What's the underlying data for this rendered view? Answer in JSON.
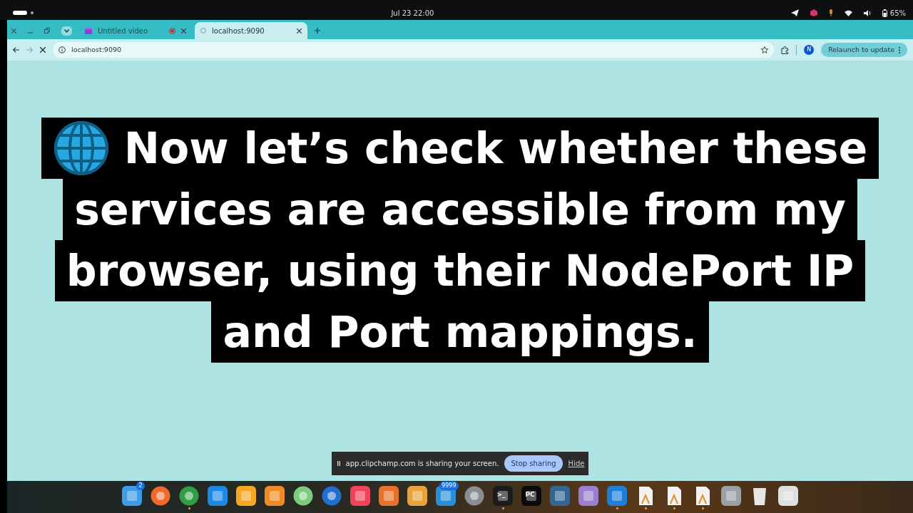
{
  "top_bar": {
    "clock": "Jul 23  22:00",
    "battery": "65%"
  },
  "tabs": [
    {
      "title": "Untitled video",
      "selected": false,
      "recording": true
    },
    {
      "title": "localhost:9090",
      "selected": true,
      "recording": false
    }
  ],
  "toolbar": {
    "loading": true,
    "forward_disabled": true,
    "url": "localhost:9090",
    "profile": "N",
    "relaunch": "Relaunch to update"
  },
  "caption": {
    "lines": [
      "Now let’s check whether these",
      "services are accessible from my",
      "browser, using their NodePort IP",
      "and Port mappings."
    ]
  },
  "share_bar": {
    "message": "app.clipchamp.com is sharing your screen.",
    "stop": "Stop sharing",
    "hide": "Hide"
  },
  "dock": [
    {
      "kind": "tile",
      "color": "#3d9be9",
      "badge": "2",
      "running": false
    },
    {
      "kind": "circle",
      "color": "#f0692a",
      "running": false
    },
    {
      "kind": "circle",
      "color": "#2f9e44",
      "running": true
    },
    {
      "kind": "tile",
      "color": "#1e88e5",
      "running": false
    },
    {
      "kind": "tile",
      "color": "#f5a623",
      "running": false
    },
    {
      "kind": "tile",
      "color": "#f08a24",
      "running": false
    },
    {
      "kind": "circle",
      "color": "#7ecb7e",
      "running": false
    },
    {
      "kind": "circle",
      "color": "#1f6fd1",
      "running": false
    },
    {
      "kind": "tile",
      "color": "#f0435a",
      "running": false
    },
    {
      "kind": "tile",
      "color": "#e8702a",
      "running": false
    },
    {
      "kind": "tile",
      "color": "#e9a33c",
      "running": false
    },
    {
      "kind": "tile",
      "color": "#2a8fd6",
      "badge": "9999",
      "running": false
    },
    {
      "kind": "circle",
      "color": "#8a8f94",
      "running": false
    },
    {
      "kind": "tile",
      "color": "#1c1c1c",
      "label": ">_",
      "running": true
    },
    {
      "kind": "tile",
      "color": "#0b0b0b",
      "label": "PC",
      "running": false
    },
    {
      "kind": "tile",
      "color": "#336791",
      "running": false
    },
    {
      "kind": "tile",
      "color": "#9a7fd1",
      "running": false
    },
    {
      "kind": "tile",
      "color": "#1e7fd8",
      "running": true
    },
    {
      "kind": "doc",
      "color": "#f2f2f2",
      "running": true
    },
    {
      "kind": "doc",
      "color": "#f2f2f2",
      "running": true
    },
    {
      "kind": "doc",
      "color": "#f2f2f2",
      "running": true
    },
    {
      "kind": "tile",
      "color": "#9aa0a6",
      "running": false
    },
    {
      "kind": "trash",
      "color": "#e6e6e6",
      "running": false
    },
    {
      "kind": "tile",
      "color": "#e0e0e0",
      "running": false
    }
  ]
}
